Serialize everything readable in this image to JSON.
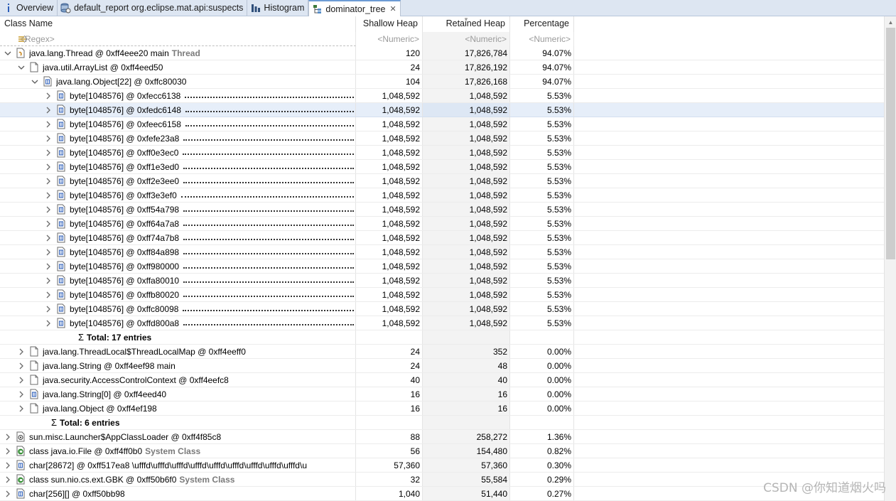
{
  "tabs": [
    {
      "label": "Overview",
      "icon": "info-icon"
    },
    {
      "label": "default_report  org.eclipse.mat.api:suspects",
      "icon": "report-icon"
    },
    {
      "label": "Histogram",
      "icon": "histogram-icon"
    },
    {
      "label": "dominator_tree",
      "icon": "tree-icon",
      "active": true,
      "close": "✕"
    }
  ],
  "columns": {
    "name": "Class Name",
    "shallow": "Shallow Heap",
    "retained": "Retained Heap",
    "percentage": "Percentage"
  },
  "filters": {
    "name": "<Regex>",
    "shallow": "<Numeric>",
    "retained": "<Numeric>",
    "percentage": "<Numeric>"
  },
  "rows": [
    {
      "indent": 0,
      "toggle": "open",
      "icon": "thread-icon",
      "label": "java.lang.Thread @ 0xff4eee20  main",
      "suffix": "Thread",
      "shallow": "120",
      "retained": "17,826,784",
      "pct": "94.07%"
    },
    {
      "indent": 1,
      "toggle": "open",
      "icon": "object-icon",
      "label": "java.util.ArrayList @ 0xff4eed50",
      "shallow": "24",
      "retained": "17,826,192",
      "pct": "94.07%"
    },
    {
      "indent": 2,
      "toggle": "open",
      "icon": "array-icon",
      "label": "java.lang.Object[22] @ 0xffc80030",
      "shallow": "104",
      "retained": "17,826,168",
      "pct": "94.07%"
    },
    {
      "indent": 3,
      "toggle": "closed",
      "icon": "array-icon",
      "label": "byte[1048576] @ 0xfecc6138",
      "dots": true,
      "shallow": "1,048,592",
      "retained": "1,048,592",
      "pct": "5.53%"
    },
    {
      "indent": 3,
      "toggle": "closed",
      "icon": "array-icon",
      "label": "byte[1048576] @ 0xfedc6148",
      "dots": true,
      "shallow": "1,048,592",
      "retained": "1,048,592",
      "pct": "5.53%",
      "selected": true
    },
    {
      "indent": 3,
      "toggle": "closed",
      "icon": "array-icon",
      "label": "byte[1048576] @ 0xfeec6158",
      "dots": true,
      "shallow": "1,048,592",
      "retained": "1,048,592",
      "pct": "5.53%"
    },
    {
      "indent": 3,
      "toggle": "closed",
      "icon": "array-icon",
      "label": "byte[1048576] @ 0xfefe23a8",
      "dots": true,
      "shallow": "1,048,592",
      "retained": "1,048,592",
      "pct": "5.53%"
    },
    {
      "indent": 3,
      "toggle": "closed",
      "icon": "array-icon",
      "label": "byte[1048576] @ 0xff0e3ec0",
      "dots": true,
      "shallow": "1,048,592",
      "retained": "1,048,592",
      "pct": "5.53%"
    },
    {
      "indent": 3,
      "toggle": "closed",
      "icon": "array-icon",
      "label": "byte[1048576] @ 0xff1e3ed0",
      "dots": true,
      "shallow": "1,048,592",
      "retained": "1,048,592",
      "pct": "5.53%"
    },
    {
      "indent": 3,
      "toggle": "closed",
      "icon": "array-icon",
      "label": "byte[1048576] @ 0xff2e3ee0",
      "dots": true,
      "shallow": "1,048,592",
      "retained": "1,048,592",
      "pct": "5.53%"
    },
    {
      "indent": 3,
      "toggle": "closed",
      "icon": "array-icon",
      "label": "byte[1048576] @ 0xff3e3ef0",
      "dots": true,
      "shallow": "1,048,592",
      "retained": "1,048,592",
      "pct": "5.53%"
    },
    {
      "indent": 3,
      "toggle": "closed",
      "icon": "array-icon",
      "label": "byte[1048576] @ 0xff54a798",
      "dots": true,
      "shallow": "1,048,592",
      "retained": "1,048,592",
      "pct": "5.53%"
    },
    {
      "indent": 3,
      "toggle": "closed",
      "icon": "array-icon",
      "label": "byte[1048576] @ 0xff64a7a8",
      "dots": true,
      "shallow": "1,048,592",
      "retained": "1,048,592",
      "pct": "5.53%"
    },
    {
      "indent": 3,
      "toggle": "closed",
      "icon": "array-icon",
      "label": "byte[1048576] @ 0xff74a7b8",
      "dots": true,
      "shallow": "1,048,592",
      "retained": "1,048,592",
      "pct": "5.53%"
    },
    {
      "indent": 3,
      "toggle": "closed",
      "icon": "array-icon",
      "label": "byte[1048576] @ 0xff84a898",
      "dots": true,
      "shallow": "1,048,592",
      "retained": "1,048,592",
      "pct": "5.53%"
    },
    {
      "indent": 3,
      "toggle": "closed",
      "icon": "array-icon",
      "label": "byte[1048576] @ 0xff980000",
      "dots": true,
      "shallow": "1,048,592",
      "retained": "1,048,592",
      "pct": "5.53%"
    },
    {
      "indent": 3,
      "toggle": "closed",
      "icon": "array-icon",
      "label": "byte[1048576] @ 0xffa80010",
      "dots": true,
      "shallow": "1,048,592",
      "retained": "1,048,592",
      "pct": "5.53%"
    },
    {
      "indent": 3,
      "toggle": "closed",
      "icon": "array-icon",
      "label": "byte[1048576] @ 0xffb80020",
      "dots": true,
      "shallow": "1,048,592",
      "retained": "1,048,592",
      "pct": "5.53%"
    },
    {
      "indent": 3,
      "toggle": "closed",
      "icon": "array-icon",
      "label": "byte[1048576] @ 0xffc80098",
      "dots": true,
      "shallow": "1,048,592",
      "retained": "1,048,592",
      "pct": "5.53%"
    },
    {
      "indent": 3,
      "toggle": "closed",
      "icon": "array-icon",
      "label": "byte[1048576] @ 0xffd800a8",
      "dots": true,
      "shallow": "1,048,592",
      "retained": "1,048,592",
      "pct": "5.53%"
    },
    {
      "indent": 3,
      "total": true,
      "sigma": "Σ",
      "label": "Total: 17 entries",
      "shallow": "",
      "retained": "",
      "pct": ""
    },
    {
      "indent": 1,
      "toggle": "closed",
      "icon": "object-icon",
      "label": "java.lang.ThreadLocal$ThreadLocalMap @ 0xff4eeff0",
      "shallow": "24",
      "retained": "352",
      "pct": "0.00%"
    },
    {
      "indent": 1,
      "toggle": "closed",
      "icon": "object-icon",
      "label": "java.lang.String @ 0xff4eef98  main",
      "shallow": "24",
      "retained": "48",
      "pct": "0.00%"
    },
    {
      "indent": 1,
      "toggle": "closed",
      "icon": "object-icon",
      "label": "java.security.AccessControlContext @ 0xff4eefc8",
      "shallow": "40",
      "retained": "40",
      "pct": "0.00%"
    },
    {
      "indent": 1,
      "toggle": "closed",
      "icon": "array-icon",
      "label": "java.lang.String[0] @ 0xff4eed40",
      "shallow": "16",
      "retained": "16",
      "pct": "0.00%"
    },
    {
      "indent": 1,
      "toggle": "closed",
      "icon": "object-icon",
      "label": "java.lang.Object @ 0xff4ef198",
      "shallow": "16",
      "retained": "16",
      "pct": "0.00%"
    },
    {
      "indent": 1,
      "total": true,
      "sigma": "Σ",
      "label": "Total: 6 entries",
      "shallow": "",
      "retained": "",
      "pct": ""
    },
    {
      "indent": 0,
      "toggle": "closed",
      "icon": "classloader-icon",
      "label": "sun.misc.Launcher$AppClassLoader @ 0xff4f85c8",
      "shallow": "88",
      "retained": "258,272",
      "pct": "1.36%"
    },
    {
      "indent": 0,
      "toggle": "closed",
      "icon": "class-icon",
      "label": "class java.io.File @ 0xff4ff0b0",
      "suffix": "System Class",
      "shallow": "56",
      "retained": "154,480",
      "pct": "0.82%"
    },
    {
      "indent": 0,
      "toggle": "closed",
      "icon": "array-icon",
      "label": "char[28672] @ 0xff517ea8  \\ufffd\\ufffd\\ufffd\\ufffd\\ufffd\\ufffd\\ufffd\\ufffd\\ufffd\\u",
      "shallow": "57,360",
      "retained": "57,360",
      "pct": "0.30%"
    },
    {
      "indent": 0,
      "toggle": "closed",
      "icon": "class-icon",
      "label": "class sun.nio.cs.ext.GBK @ 0xff50b6f0",
      "suffix": "System Class",
      "shallow": "32",
      "retained": "55,584",
      "pct": "0.29%"
    },
    {
      "indent": 0,
      "toggle": "closed",
      "icon": "array-icon",
      "label": "char[256][] @ 0xff50bb98",
      "shallow": "1,040",
      "retained": "51,440",
      "pct": "0.27%"
    }
  ],
  "watermark": "CSDN @你知道烟火吗",
  "colors": {
    "tabbar": "#dde6f2",
    "selection": "#e6eef9",
    "retained_column": "#f3f3f3"
  }
}
